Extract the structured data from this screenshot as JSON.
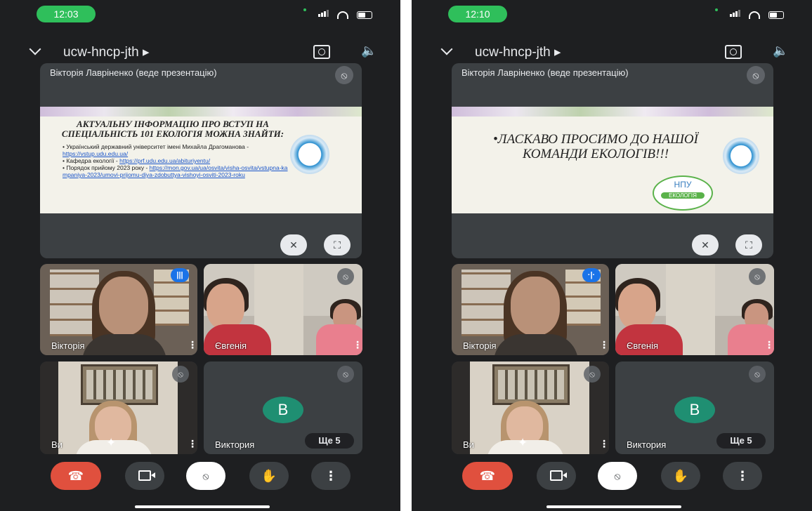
{
  "screens": [
    {
      "time": "12:03",
      "meeting_code": "ucw-hncp-jth ▸",
      "presenter_label": "Вікторія Лавріненко (веде презентацію)",
      "slide": {
        "heading": "Актуальну інформацію про вступ на спеціальність 101 Екологія можна знайти:",
        "bullets": [
          {
            "text": "Український державний університет імені Михайла Драгоманова - ",
            "link": "https://vstup.udu.edu.ua/"
          },
          {
            "text": "Кафедра екології - ",
            "link": "https://prf.udu.edu.ua/abituriyentu/"
          },
          {
            "text": "Порядок прийому 2023 року - ",
            "link": "https://mon.gov.ua/ua/osvita/visha-osvita/vstupna-kampaniya-2023/umovi-prijomu-diya-zdobuttya-vishoyi-osviti-2023-roku"
          }
        ]
      },
      "tiles": {
        "t1_name": "Вікторія",
        "t2_name": "Євгенія",
        "t3_name": "Ви",
        "t4_name": "Виктория",
        "t4_avatar": "B",
        "more_badge": "Ще 5"
      }
    },
    {
      "time": "12:10",
      "meeting_code": "ucw-hncp-jth ▸",
      "presenter_label": "Вікторія Лавріненко (веде презентацію)",
      "slide": {
        "greeting": "•Ласкаво просимо до нашої команди екологів!!!",
        "logo_top": "НПУ",
        "logo_bottom": "ЕКОЛОГІЯ"
      },
      "tiles": {
        "t1_name": "Вікторія",
        "t2_name": "Євгенія",
        "t3_name": "Ви",
        "t4_name": "Виктория",
        "t4_avatar": "B",
        "more_badge": "Ще 5"
      }
    }
  ],
  "icons": {
    "mic_off": "mic-off-icon",
    "speaking": "speaking-indicator-icon",
    "camera_flip": "camera-flip-icon",
    "speaker": "speaker-icon",
    "end_call": "end-call-icon",
    "camera": "camera-icon",
    "raise_hand": "raise-hand-icon",
    "more": "more-vert-icon",
    "sparkle": "effects-sparkle-icon",
    "fullscreen": "fullscreen-icon",
    "pin_off": "pin-off-icon"
  },
  "colors": {
    "background": "#1e1f21",
    "tile": "#3c4043",
    "end_call": "#e0503e",
    "speaking_blue": "#1a73e8",
    "time_pill": "#2fbf5b",
    "avatar": "#1f8f72"
  }
}
